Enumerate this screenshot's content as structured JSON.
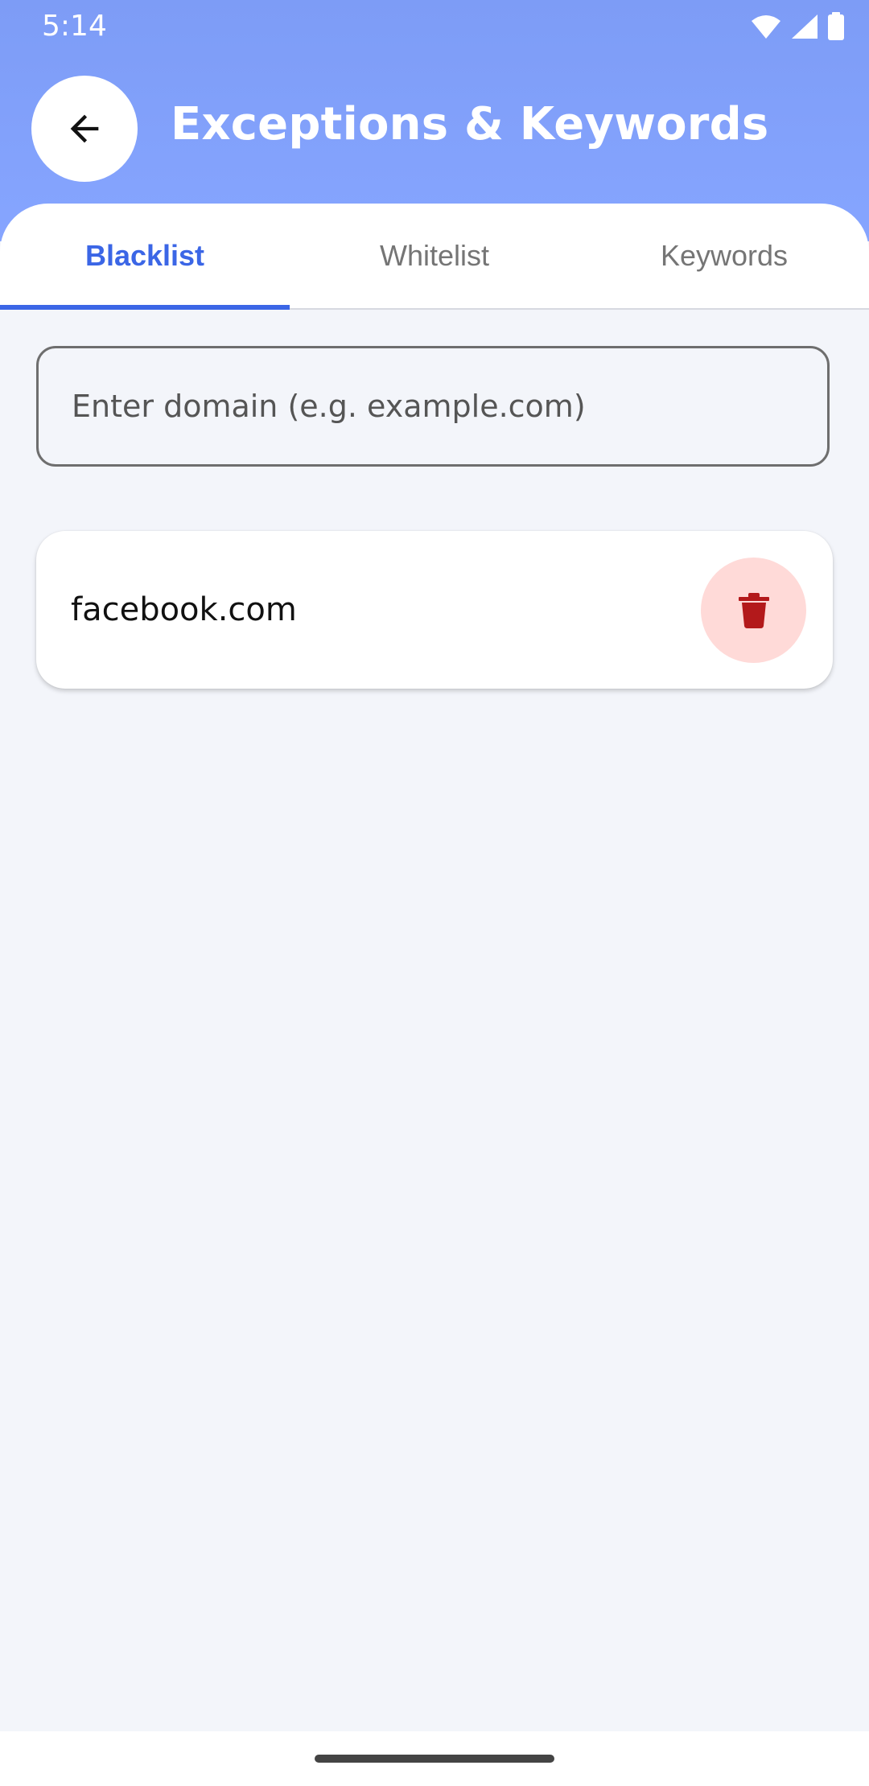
{
  "status_bar": {
    "time": "5:14",
    "icons": [
      "wifi-icon",
      "cellular-icon",
      "battery-icon"
    ]
  },
  "header": {
    "title": "Exceptions & Keywords",
    "back_icon": "arrow-left-icon"
  },
  "tabs": [
    {
      "label": "Blacklist",
      "active": true
    },
    {
      "label": "Whitelist",
      "active": false
    },
    {
      "label": "Keywords",
      "active": false
    }
  ],
  "domain_input": {
    "placeholder": "Enter domain (e.g. example.com)",
    "value": ""
  },
  "blacklist_items": [
    {
      "domain": "facebook.com",
      "delete_icon": "trash-icon"
    }
  ],
  "colors": {
    "header": "#86a5ff",
    "accent": "#3b66e6",
    "background": "#f3f5fa",
    "delete_bg": "#ffdad8",
    "delete_icon": "#b3191b"
  }
}
